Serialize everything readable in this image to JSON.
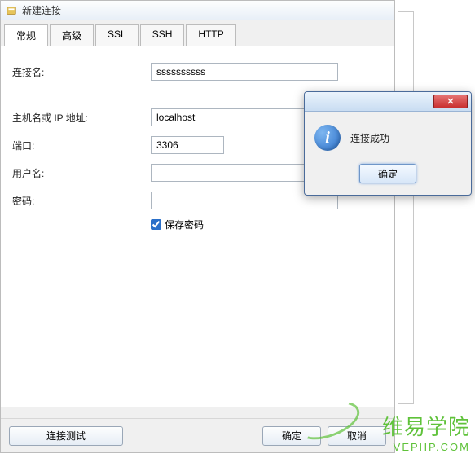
{
  "window": {
    "title": "新建连接"
  },
  "tabs": [
    {
      "label": "常规",
      "active": true
    },
    {
      "label": "高级",
      "active": false
    },
    {
      "label": "SSL",
      "active": false
    },
    {
      "label": "SSH",
      "active": false
    },
    {
      "label": "HTTP",
      "active": false
    }
  ],
  "form": {
    "connection_name_label": "连接名:",
    "connection_name_value": "ssssssssss",
    "host_label": "主机名或 IP 地址:",
    "host_value": "localhost",
    "port_label": "端口:",
    "port_value": "3306",
    "username_label": "用户名:",
    "username_value": "",
    "password_label": "密码:",
    "password_value": "",
    "save_password_label": "保存密码",
    "save_password_checked": true
  },
  "buttons": {
    "test_connection": "连接测试",
    "ok": "确定",
    "cancel": "取消"
  },
  "popup": {
    "message": "连接成功",
    "ok": "确定"
  },
  "watermark": {
    "main": "维易学院",
    "sub": "VEPHP.COM"
  }
}
